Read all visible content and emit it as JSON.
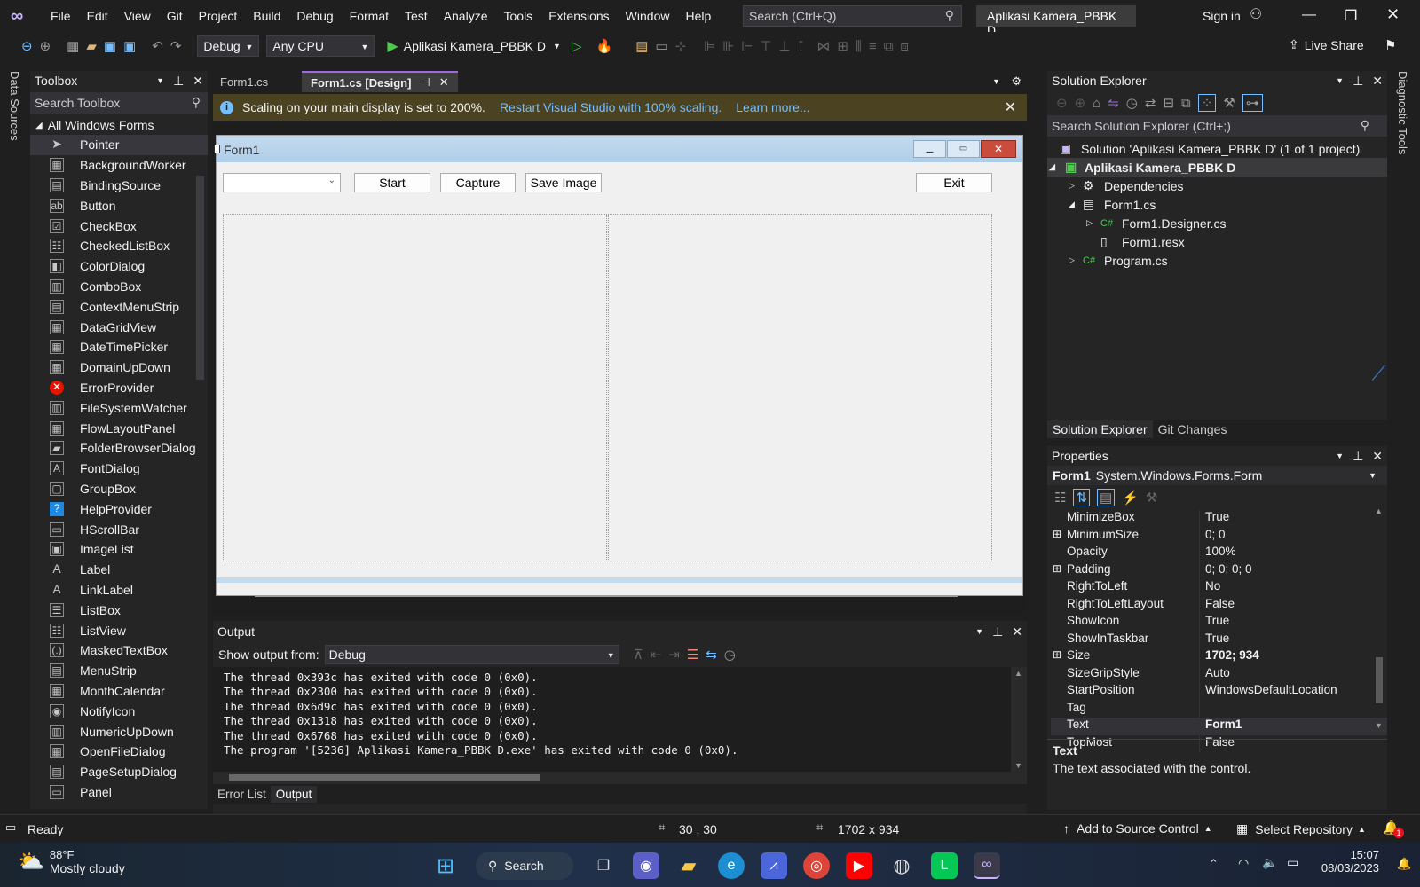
{
  "menu": [
    "File",
    "Edit",
    "View",
    "Git",
    "Project",
    "Build",
    "Debug",
    "Format",
    "Test",
    "Analyze",
    "Tools",
    "Extensions",
    "Window",
    "Help"
  ],
  "search_placeholder": "Search (Ctrl+Q)",
  "project_title": "Aplikasi Kamera_PBBK D",
  "sign_in": "Sign in",
  "toolbar": {
    "config": "Debug",
    "platform": "Any CPU",
    "run_label": "Aplikasi Kamera_PBBK D",
    "live_share": "Live Share"
  },
  "left_vtab": "Data Sources",
  "right_vtab": "Diagnostic Tools",
  "toolbox": {
    "title": "Toolbox",
    "search": "Search Toolbox",
    "group": "All Windows Forms",
    "items": [
      "Pointer",
      "BackgroundWorker",
      "BindingSource",
      "Button",
      "CheckBox",
      "CheckedListBox",
      "ColorDialog",
      "ComboBox",
      "ContextMenuStrip",
      "DataGridView",
      "DateTimePicker",
      "DomainUpDown",
      "ErrorProvider",
      "FileSystemWatcher",
      "FlowLayoutPanel",
      "FolderBrowserDialog",
      "FontDialog",
      "GroupBox",
      "HelpProvider",
      "HScrollBar",
      "ImageList",
      "Label",
      "LinkLabel",
      "ListBox",
      "ListView",
      "MaskedTextBox",
      "MenuStrip",
      "MonthCalendar",
      "NotifyIcon",
      "NumericUpDown",
      "OpenFileDialog",
      "PageSetupDialog",
      "Panel"
    ]
  },
  "doc_tabs": [
    "Form1.cs",
    "Form1.cs [Design]"
  ],
  "infobar": {
    "message": "Scaling on your main display is set to 200%.",
    "link1": "Restart Visual Studio with 100% scaling.",
    "link2": "Learn more..."
  },
  "form": {
    "title": "Form1",
    "buttons": {
      "start": "Start",
      "capture": "Capture",
      "save": "Save Image",
      "exit": "Exit"
    }
  },
  "output": {
    "title": "Output",
    "show_from_label": "Show output from:",
    "source": "Debug",
    "lines": [
      "The thread 0x393c has exited with code 0 (0x0).",
      "The thread 0x2300 has exited with code 0 (0x0).",
      "The thread 0x6d9c has exited with code 0 (0x0).",
      "The thread 0x1318 has exited with code 0 (0x0).",
      "The thread 0x6768 has exited with code 0 (0x0).",
      "The program '[5236] Aplikasi Kamera_PBBK D.exe' has exited with code 0 (0x0)."
    ],
    "tabs": [
      "Error List",
      "Output"
    ]
  },
  "solution_explorer": {
    "title": "Solution Explorer",
    "search": "Search Solution Explorer (Ctrl+;)",
    "items": [
      {
        "label": "Solution 'Aplikasi Kamera_PBBK D' (1 of 1 project)",
        "icon": "solution-icon"
      },
      {
        "label": "Aplikasi Kamera_PBBK D",
        "icon": "csharp-project-icon"
      },
      {
        "label": "Dependencies",
        "icon": "dependencies-icon"
      },
      {
        "label": "Form1.cs",
        "icon": "form-icon"
      },
      {
        "label": "Form1.Designer.cs",
        "icon": "csharp-file-icon"
      },
      {
        "label": "Form1.resx",
        "icon": "resx-file-icon"
      },
      {
        "label": "Program.cs",
        "icon": "csharp-file-icon"
      }
    ],
    "tabs": [
      "Solution Explorer",
      "Git Changes"
    ]
  },
  "properties": {
    "title": "Properties",
    "object_name": "Form1",
    "object_type": "System.Windows.Forms.Form",
    "rows": [
      {
        "name": "MinimizeBox",
        "value": "True"
      },
      {
        "name": "MinimumSize",
        "value": "0; 0"
      },
      {
        "name": "Opacity",
        "value": "100%"
      },
      {
        "name": "Padding",
        "value": "0; 0; 0; 0"
      },
      {
        "name": "RightToLeft",
        "value": "No"
      },
      {
        "name": "RightToLeftLayout",
        "value": "False"
      },
      {
        "name": "ShowIcon",
        "value": "True"
      },
      {
        "name": "ShowInTaskbar",
        "value": "True"
      },
      {
        "name": "Size",
        "value": "1702; 934"
      },
      {
        "name": "SizeGripStyle",
        "value": "Auto"
      },
      {
        "name": "StartPosition",
        "value": "WindowsDefaultLocation"
      },
      {
        "name": "Tag",
        "value": ""
      },
      {
        "name": "Text",
        "value": "Form1"
      },
      {
        "name": "TopMost",
        "value": "False"
      }
    ],
    "desc_title": "Text",
    "desc_text": "The text associated with the control."
  },
  "status": {
    "ready": "Ready",
    "position": "30 , 30",
    "size": "1702 x 934",
    "source_control": "Add to Source Control",
    "repository": "Select Repository",
    "notifications": "1"
  },
  "taskbar": {
    "temp": "88°F",
    "weather": "Mostly cloudy",
    "search": "Search",
    "time": "15:07",
    "date": "08/03/2023"
  },
  "colors": {
    "accent": "#007acc",
    "vs_purple": "#9b6bdf",
    "info_bar": "#4a4220",
    "link": "#75beff"
  }
}
